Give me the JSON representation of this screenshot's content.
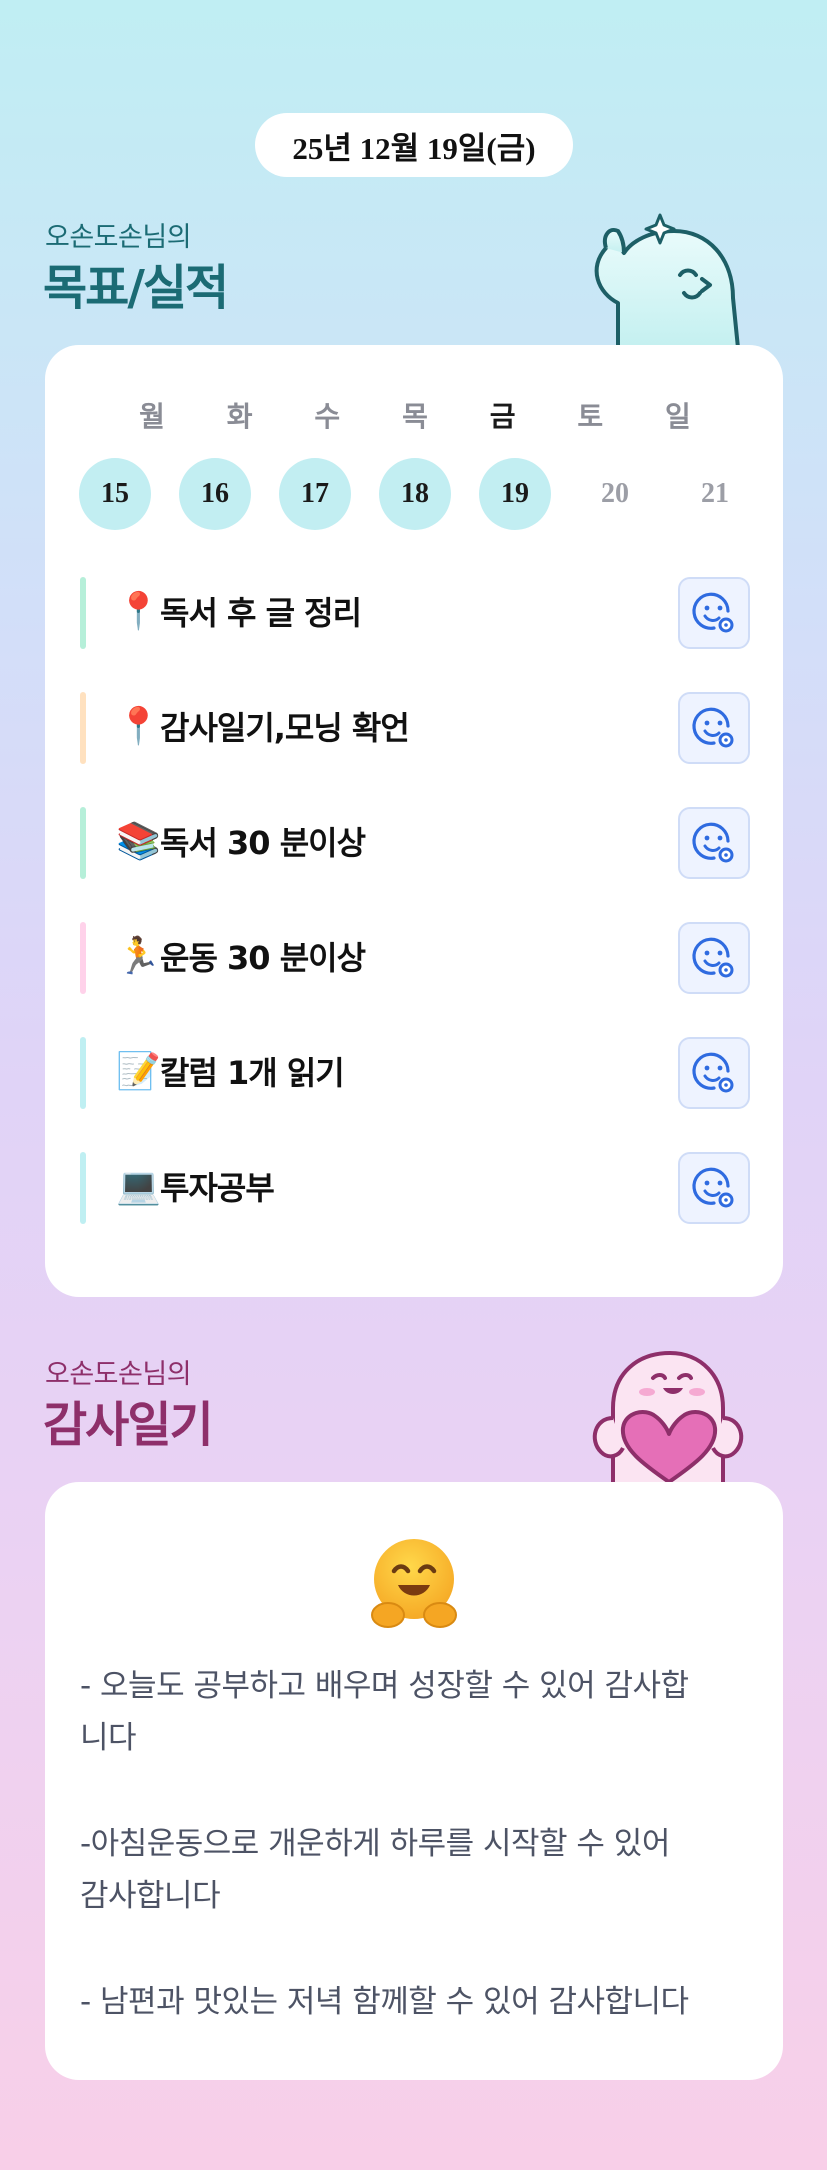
{
  "date_label": "25년 12월 19일(금)",
  "goals_section": {
    "subtitle": "오손도손님의",
    "title": "목표/실적"
  },
  "week": {
    "days": [
      {
        "name": "월",
        "date": "15",
        "state": "done"
      },
      {
        "name": "화",
        "date": "16",
        "state": "done"
      },
      {
        "name": "수",
        "date": "17",
        "state": "done"
      },
      {
        "name": "목",
        "date": "18",
        "state": "done"
      },
      {
        "name": "금",
        "date": "19",
        "state": "today"
      },
      {
        "name": "토",
        "date": "20",
        "state": "future"
      },
      {
        "name": "일",
        "date": "21",
        "state": "future"
      }
    ]
  },
  "goals": [
    {
      "emoji": "📍",
      "label": "독서 후 글 정리",
      "bar_color": "#b6efd9"
    },
    {
      "emoji": "📍",
      "label": "감사일기,모닝 확언",
      "bar_color": "#ffe1bf"
    },
    {
      "emoji": "📚",
      "label": "독서 30 분이상",
      "bar_color": "#b6efd9"
    },
    {
      "emoji": "🏃",
      "label": "운동 30 분이상",
      "bar_color": "#ffd2ea"
    },
    {
      "emoji": "📝",
      "label": "칼럼 1개 읽기",
      "bar_color": "#bfeff2"
    },
    {
      "emoji": "💻",
      "label": "투자공부",
      "bar_color": "#bfeff2"
    }
  ],
  "thanks_section": {
    "subtitle": "오손도손님의",
    "title": "감사일기"
  },
  "thanks": {
    "emoji": "🤗",
    "lines": [
      "- 오늘도 공부하고 배우며 성장할 수 있어 감사합",
      "니다",
      "",
      "-아침운동으로 개운하게 하루를 시작할 수 있어",
      "감사합니다",
      "",
      "- 남편과 맛있는 저녁 함께할 수 있어 감사합니다"
    ]
  },
  "colors": {
    "accent_teal": "#1b6b74",
    "accent_plum": "#8e2f6a",
    "done_day": "#c2eef2",
    "react_icon": "#2f6be0"
  },
  "icons": {
    "reaction": "smile-add-icon",
    "mascot_top": "ghost-thumbs-up-mascot",
    "mascot_bottom": "pink-ghost-heart-mascot"
  }
}
